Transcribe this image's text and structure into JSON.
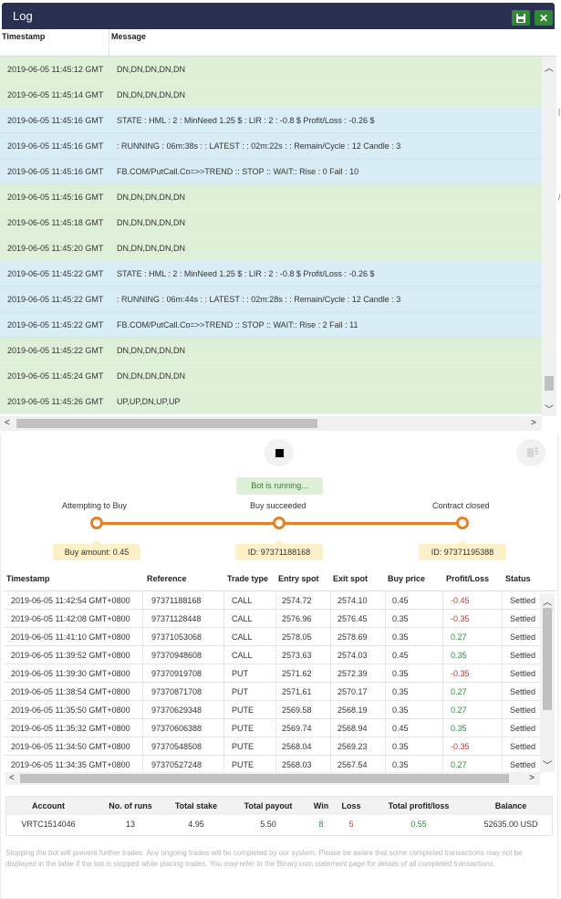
{
  "log": {
    "title": "Log",
    "columns": {
      "timestamp": "Timestamp",
      "message": "Message"
    },
    "rows": [
      {
        "ts": "2019-06-05 11:45:12 GMT",
        "msg": "DN,DN,DN,DN,DN",
        "color": "green"
      },
      {
        "ts": "2019-06-05 11:45:14 GMT",
        "msg": "DN,DN,DN,DN,DN",
        "color": "green"
      },
      {
        "ts": "2019-06-05 11:45:16 GMT",
        "msg": "STATE : HML : 2 : MinNeed 1.25 $ : LIR : 2 : -0.8 $ Profit/Loss : -0.26 $",
        "color": "blue"
      },
      {
        "ts": "2019-06-05 11:45:16 GMT",
        "msg": ": RUNNING : 06m:38s : : LATEST : : 02m:22s : : Remain/Cycle : 12 Candle : 3",
        "color": "blue"
      },
      {
        "ts": "2019-06-05 11:45:16 GMT",
        "msg": "FB.COM/PutCall.Co=>>TREND :: STOP :: WAIT:: Rise : 0 Fall : 10",
        "color": "blue"
      },
      {
        "ts": "2019-06-05 11:45:16 GMT",
        "msg": "DN,DN,DN,DN,DN",
        "color": "green"
      },
      {
        "ts": "2019-06-05 11:45:18 GMT",
        "msg": "DN,DN,DN,DN,DN",
        "color": "green"
      },
      {
        "ts": "2019-06-05 11:45:20 GMT",
        "msg": "DN,DN,DN,DN,DN",
        "color": "green"
      },
      {
        "ts": "2019-06-05 11:45:22 GMT",
        "msg": "STATE : HML : 2 : MinNeed 1.25 $ : LIR : 2 : -0.8 $ Profit/Loss : -0.26 $",
        "color": "blue"
      },
      {
        "ts": "2019-06-05 11:45:22 GMT",
        "msg": ": RUNNING : 06m:44s : : LATEST : : 02m:28s : : Remain/Cycle : 12 Candle : 3",
        "color": "blue"
      },
      {
        "ts": "2019-06-05 11:45:22 GMT",
        "msg": "FB.COM/PutCall.Co=>>TREND :: STOP :: WAIT:: Rise : 2 Fall : 11",
        "color": "blue"
      },
      {
        "ts": "2019-06-05 11:45:22 GMT",
        "msg": "DN,DN,DN,DN,DN",
        "color": "green"
      },
      {
        "ts": "2019-06-05 11:45:24 GMT",
        "msg": "DN,DN,DN,DN,DN",
        "color": "green"
      },
      {
        "ts": "2019-06-05 11:45:26 GMT",
        "msg": "UP,UP,DN,UP,UP",
        "color": "green"
      }
    ]
  },
  "bot": {
    "status": "Bot is running...",
    "steps": [
      {
        "label": "Attempting to Buy",
        "tip": "Buy amount: 0.45"
      },
      {
        "label": "Buy succeeded",
        "tip": "ID: 97371188168"
      },
      {
        "label": "Contract closed",
        "tip": "ID: 97371195388"
      }
    ]
  },
  "transactions": {
    "headers": [
      "Timestamp",
      "Reference",
      "Trade type",
      "Entry spot",
      "Exit spot",
      "Buy price",
      "Profit/Loss",
      "Status"
    ],
    "rows": [
      [
        "2019-06-05 11:42:54 GMT+0800",
        "97371188168",
        "CALL",
        "2574.72",
        "2574.10",
        "0.45",
        "-0.45",
        "Settled"
      ],
      [
        "2019-06-05 11:42:08 GMT+0800",
        "97371128448",
        "CALL",
        "2576.96",
        "2576.45",
        "0.35",
        "-0.35",
        "Settled"
      ],
      [
        "2019-06-05 11:41:10 GMT+0800",
        "97371053068",
        "CALL",
        "2578.05",
        "2578.69",
        "0.35",
        "0.27",
        "Settled"
      ],
      [
        "2019-06-05 11:39:52 GMT+0800",
        "97370948608",
        "CALL",
        "2573.63",
        "2574.03",
        "0.45",
        "0.35",
        "Settled"
      ],
      [
        "2019-06-05 11:39:30 GMT+0800",
        "97370919708",
        "PUT",
        "2571.62",
        "2572.39",
        "0.35",
        "-0.35",
        "Settled"
      ],
      [
        "2019-06-05 11:38:54 GMT+0800",
        "97370871708",
        "PUT",
        "2571.61",
        "2570.17",
        "0.35",
        "0.27",
        "Settled"
      ],
      [
        "2019-06-05 11:35:50 GMT+0800",
        "97370629348",
        "PUTE",
        "2569.58",
        "2568.19",
        "0.35",
        "0.27",
        "Settled"
      ],
      [
        "2019-06-05 11:35:32 GMT+0800",
        "97370606388",
        "PUTE",
        "2569.74",
        "2568.94",
        "0.45",
        "0.35",
        "Settled"
      ],
      [
        "2019-06-05 11:34:50 GMT+0800",
        "97370548508",
        "PUTE",
        "2568.04",
        "2569.23",
        "0.35",
        "-0.35",
        "Settled"
      ],
      [
        "2019-06-05 11:34:35 GMT+0800",
        "97370527248",
        "PUTE",
        "2568.03",
        "2567.54",
        "0.35",
        "0.27",
        "Settled"
      ]
    ]
  },
  "summary": {
    "headers": [
      "Account",
      "No. of runs",
      "Total stake",
      "Total payout",
      "Win",
      "Loss",
      "Total profit/loss",
      "Balance"
    ],
    "values": [
      "VRTC1514046",
      "13",
      "4.95",
      "5.50",
      "8",
      "5",
      "0.55",
      "52635.00 USD"
    ]
  },
  "disclaimer": "Stopping the bot will prevent further trades. Any ongoing trades will be completed by our system. Please be aware that some completed transactions may not be displayed in the table if the bot is stopped while placing trades. You may refer to the Binary.com statement page for details of all completed transactions.",
  "colors": {
    "header": "#2a3052",
    "accent_green": "#2e8836",
    "progress": "#e98024",
    "row_green": "#dff0d8",
    "row_blue": "#d9edf7",
    "tip_bg": "#fcf0c8",
    "loss_red": "#c0392b"
  },
  "icons": [
    "save-icon",
    "close-icon",
    "stop-icon",
    "clear-icon",
    "scroll-up-icon",
    "scroll-down-icon",
    "scroll-left-icon",
    "scroll-right-icon"
  ]
}
